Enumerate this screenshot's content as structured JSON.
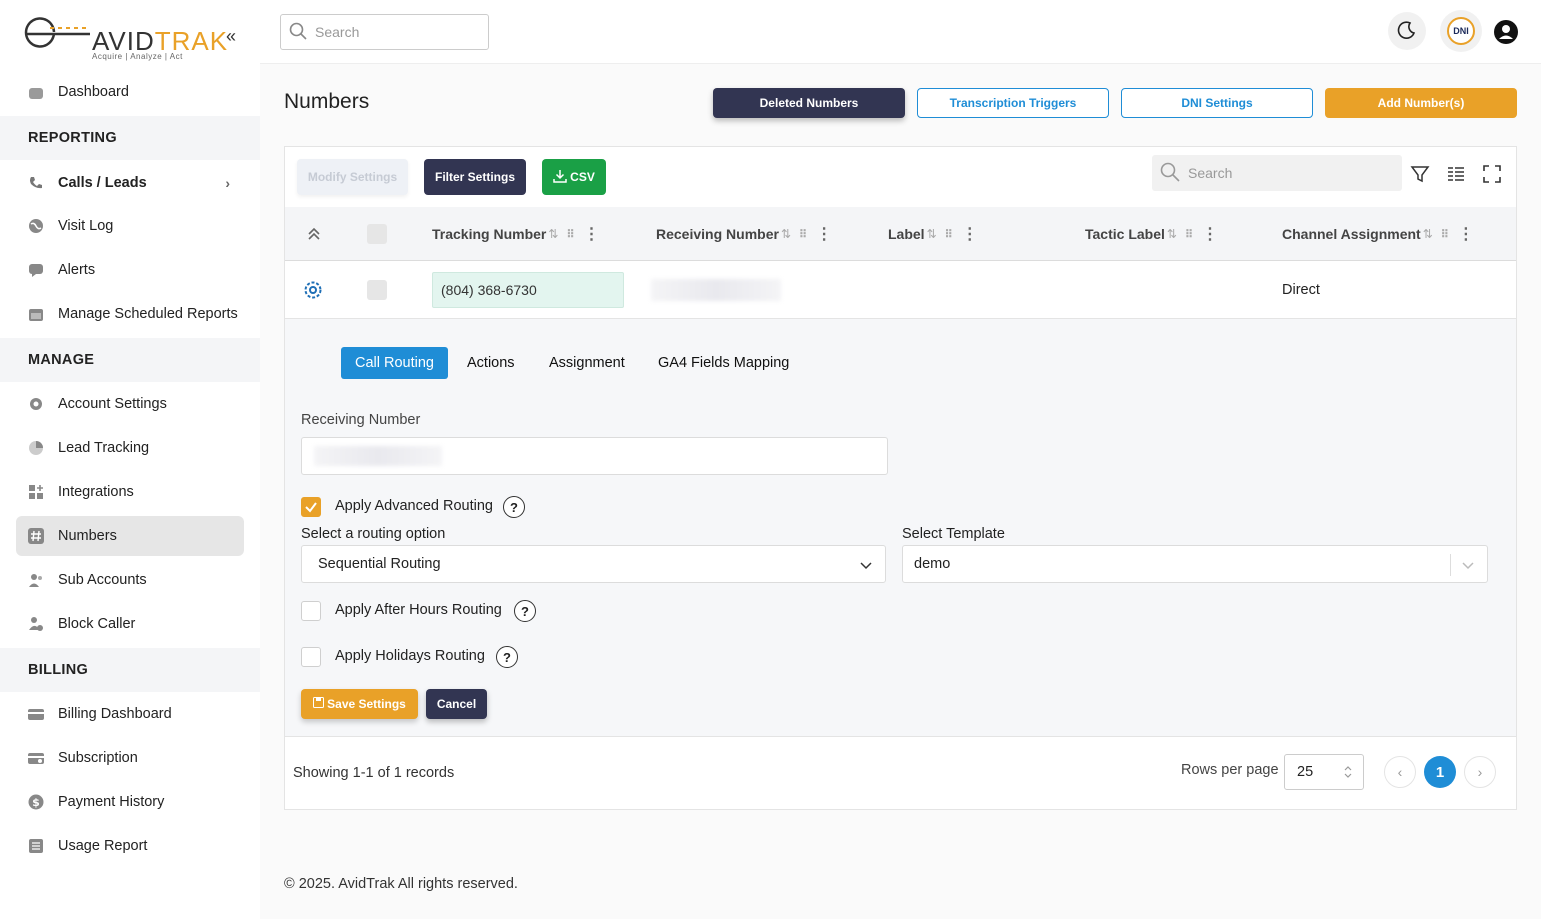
{
  "brand": {
    "name_main": "AVID",
    "name_accent": "TRAK",
    "tagline": "Acquire  |  Analyze  |  Act"
  },
  "sidebar": {
    "collapse_icon": "double-chevron-left",
    "items": [
      {
        "label": "Dashboard",
        "icon": "home-icon"
      },
      {
        "section": "REPORTING"
      },
      {
        "label": "Calls / Leads",
        "icon": "phone-icon"
      },
      {
        "label": "Visit Log",
        "icon": "globe-icon"
      },
      {
        "label": "Alerts",
        "icon": "chat-icon"
      },
      {
        "label": "Manage Scheduled Reports",
        "icon": "calendar-icon"
      },
      {
        "section": "MANAGE"
      },
      {
        "label": "Account Settings",
        "icon": "gear-icon"
      },
      {
        "label": "Lead Tracking",
        "icon": "pie-icon"
      },
      {
        "label": "Integrations",
        "icon": "grid-plus-icon"
      },
      {
        "label": "Numbers",
        "icon": "hash-icon"
      },
      {
        "label": "Sub Accounts",
        "icon": "users-icon"
      },
      {
        "label": "Block Caller",
        "icon": "user-block-icon"
      },
      {
        "section": "BILLING"
      },
      {
        "label": "Billing Dashboard",
        "icon": "card-icon"
      },
      {
        "label": "Subscription",
        "icon": "card-refresh-icon"
      },
      {
        "label": "Payment History",
        "icon": "dollar-icon"
      },
      {
        "label": "Usage Report",
        "icon": "report-icon"
      }
    ]
  },
  "topbar": {
    "search_placeholder": "Search",
    "dni_label": "DNI"
  },
  "page": {
    "title": "Numbers",
    "buttons": {
      "deleted": "Deleted Numbers",
      "transcription": "Transcription Triggers",
      "dni": "DNI Settings",
      "add": "Add Number(s)"
    }
  },
  "toolbar": {
    "modify": "Modify Settings",
    "filter": "Filter Settings",
    "csv": "CSV",
    "search_placeholder": "Search"
  },
  "table": {
    "columns": [
      "Tracking Number",
      "Receiving Number",
      "Label",
      "Tactic Label",
      "Channel Assignment"
    ],
    "rows": [
      {
        "tracking": "(804) 368-6730",
        "receiving": "",
        "label": "",
        "tactic": "",
        "channel": "Direct"
      }
    ]
  },
  "detail": {
    "tabs": [
      "Call Routing",
      "Actions",
      "Assignment",
      "GA4 Fields Mapping"
    ],
    "active_tab": "Call Routing",
    "receiving_label": "Receiving Number",
    "advanced_routing": {
      "label": "Apply Advanced Routing",
      "checked": true
    },
    "routing_option_label": "Select a routing option",
    "routing_option_value": "Sequential Routing",
    "template_label": "Select Template",
    "template_value": "demo",
    "after_hours": {
      "label": "Apply After Hours Routing",
      "checked": false
    },
    "holidays": {
      "label": "Apply Holidays Routing",
      "checked": false
    },
    "save": "Save Settings",
    "cancel": "Cancel"
  },
  "pagination": {
    "info": "Showing 1-1 of 1 records",
    "rows_per_page_label": "Rows per page",
    "rows_per_page": "25",
    "current_page": "1"
  },
  "footer": {
    "copyright": "© 2025. AvidTrak All rights reserved."
  },
  "colors": {
    "accent_orange": "#e9a128",
    "primary_blue": "#1f8dd6",
    "dark_navy": "#323552",
    "csv_green": "#1aa046"
  }
}
